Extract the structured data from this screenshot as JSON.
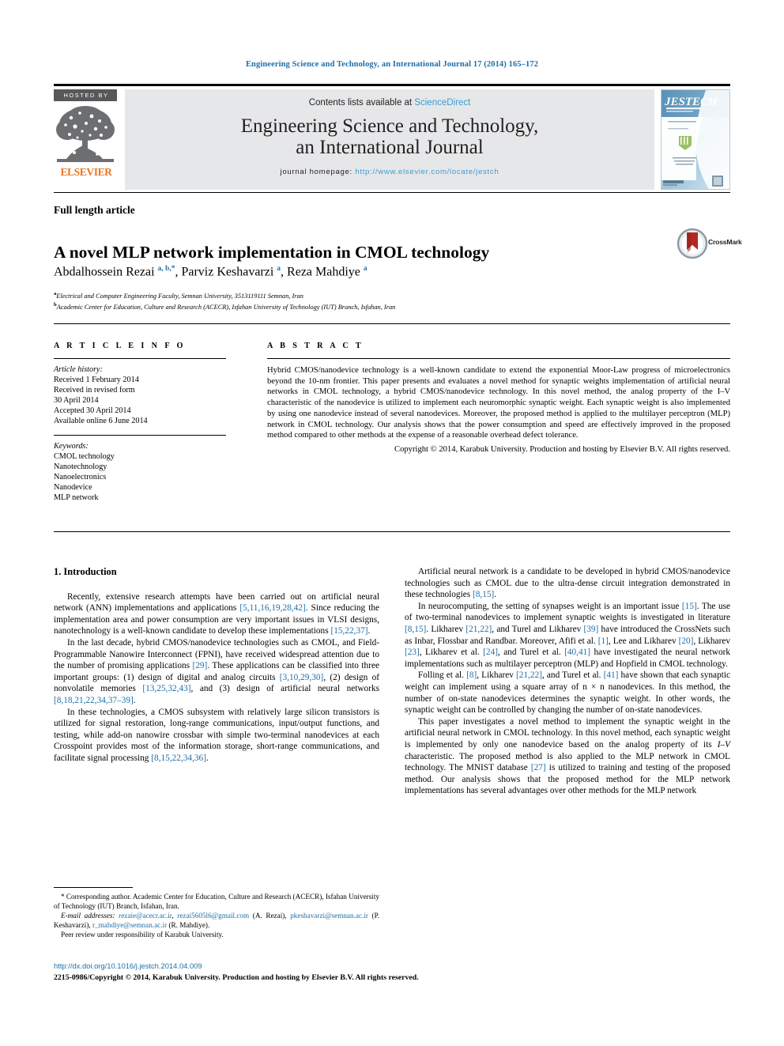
{
  "running_head": "Engineering Science and Technology, an International Journal 17 (2014) 165–172",
  "masthead": {
    "hosted_by": "HOSTED BY",
    "publisher": "ELSEVIER",
    "contents_prefix": "Contents lists available at ",
    "contents_link": "ScienceDirect",
    "journal_line1": "Engineering Science and Technology,",
    "journal_line2": "an International Journal",
    "homepage_label": "journal homepage: ",
    "homepage_url": "http://www.elsevier.com/locate/jestch",
    "cover_title": "JESTECH",
    "cover_subtitle": "ENGINEERING SCIENCE AND TECHNOLOGY",
    "cover_sub2": "an International Journal"
  },
  "article": {
    "type": "Full length article",
    "title": "A novel MLP network implementation in CMOL technology",
    "crossmark_label": "CrossMark",
    "authors_html": "Abdalhossein Rezai <sup>a, b,</sup><sup>*</sup>, Parviz Keshavarzi <sup>a</sup>, Reza Mahdiye <sup>a</sup>",
    "affiliation_a": "Electrical and Computer Engineering Faculty, Semnan University, 3513119111 Semnan, Iran",
    "affiliation_b": "Academic Center for Education, Culture and Research (ACECR), Isfahan University of Technology (IUT) Branch, Isfahan, Iran"
  },
  "article_info": {
    "heading": "A R T I C L E   I N F O",
    "history_label": "Article history:",
    "history": [
      "Received 1 February 2014",
      "Received in revised form",
      "30 April 2014",
      "Accepted 30 April 2014",
      "Available online 6 June 2014"
    ],
    "keywords_label": "Keywords:",
    "keywords": [
      "CMOL technology",
      "Nanotechnology",
      "Nanoelectronics",
      "Nanodevice",
      "MLP network"
    ]
  },
  "abstract": {
    "heading": "A B S T R A C T",
    "body_html": "Hybrid CMOS/nanodevice technology is a well-known candidate to extend the exponential Moor-Law progress of microelectronics beyond the 10-nm frontier. This paper presents and evaluates a novel method for synaptic weights implementation of artificial neural networks in CMOL technology, a hybrid CMOS/nanodevice technology. In this novel method, the analog property of the <span class=\"it\">I&#8211;V</span> characteristic of the nanodevice is utilized to implement each neuromorphic synaptic weight. Each synaptic weight is also implemented by using one nanodevice instead of several nanodevices. Moreover, the proposed method is applied to the multilayer perceptron (MLP) network in CMOL technology. Our analysis shows that the power consumption and speed are effectively improved in the proposed method compared to other methods at the expense of a reasonable overhead defect tolerance.",
    "copyright": "Copyright © 2014, Karabuk University. Production and hosting by Elsevier B.V. All rights reserved."
  },
  "body": {
    "section_heading": "1. Introduction",
    "left_paragraphs_html": [
      "Recently, extensive research attempts have been carried out on artificial neural network (ANN) implementations and applications <span class=\"ref\">[5,11,16,19,28,42]</span>. Since reducing the implementation area and power consumption are very important issues in VLSI designs, nanotechnology is a well-known candidate to develop these implementations <span class=\"ref\">[15,22,37]</span>.",
      "In the last decade, hybrid CMOS/nanodevice technologies such as CMOL, and Field-Programmable Nanowire Interconnect (FPNI), have received widespread attention due to the number of promising applications <span class=\"ref\">[29]</span>. These applications can be classified into three important groups: (1) design of digital and analog circuits <span class=\"ref\">[3,10,29,30]</span>, (2) design of nonvolatile memories <span class=\"ref\">[13,25,32,43]</span>, and (3) design of artificial neural networks <span class=\"ref\">[8,18,21,22,34,37&#8211;39]</span>.",
      "In these technologies, a CMOS subsystem with relatively large silicon transistors is utilized for signal restoration, long-range communications, input/output functions, and testing, while add-on nanowire crossbar with simple two-terminal nanodevices at each Crosspoint provides most of the information storage, short-range communications, and facilitate signal processing <span class=\"ref\">[8,15,22,34,36]</span>."
    ],
    "right_paragraphs_html": [
      "Artificial neural network is a candidate to be developed in hybrid CMOS/nanodevice technologies such as CMOL due to the ultra-dense circuit integration demonstrated in these technologies <span class=\"ref\">[8,15]</span>.",
      "In neurocomputing, the setting of synapses weight is an important issue <span class=\"ref\">[15]</span>. The use of two-terminal nanodevices to implement synaptic weights is investigated in literature <span class=\"ref\">[8,15]</span>. Likharev <span class=\"ref\">[21,22]</span>, and Turel and Likharev <span class=\"ref\">[39]</span> have introduced the CrossNets such as Inbar, Flossbar and Randbar. Moreover, Afifi et al. <span class=\"ref\">[1]</span>, Lee and Likharev <span class=\"ref\">[20]</span>, Likharev <span class=\"ref\">[23]</span>, Likharev et al. <span class=\"ref\">[24]</span>, and Turel et al. <span class=\"ref\">[40,41]</span> have investigated the neural network implementations such as multilayer perceptron (MLP) and Hopfield in CMOL technology.",
      "Folling et al. <span class=\"ref\">[8]</span>, Likharev <span class=\"ref\">[21,22]</span>, and Turel et al. <span class=\"ref\">[41]</span> have shown that each synaptic weight can implement using a square array of n × n nanodevices. In this method, the number of on-state nanodevices determines the synaptic weight. In other words, the synaptic weight can be controlled by changing the number of on-state nanodevices.",
      "This paper investigates a novel method to implement the synaptic weight in the artificial neural network in CMOL technology. In this novel method, each synaptic weight is implemented by only one nanodevice based on the analog property of its <span class=\"it\">I&#8211;V</span> characteristic. The proposed method is also applied to the MLP network in CMOL technology. The MNIST database <span class=\"ref\">[27]</span> is utilized to training and testing of the proposed method. Our analysis shows that the proposed method for the MLP network implementations has several advantages over other methods for the MLP network"
    ]
  },
  "footnotes": {
    "corresponding_html": "* Corresponding author. Academic Center for Education, Culture and Research (ACECR), Isfahan University of Technology (IUT) Branch, Isfahan, Iran.",
    "emails_html": "<span class=\"it\">E-mail addresses:</span> <span class=\"mail\">rezaie@acecr.ac.ir</span>, <span class=\"mail\">rezai5605l6@gmail.com</span> (A. Rezai), <span class=\"mail\">pkeshavarzi@semnan.ac.ir</span> (P. Keshavarzi), <span class=\"mail\">r_mahdiye@semnan.ac.ir</span> (R. Mahdiye).",
    "peer_review": "Peer review under responsibility of Karabuk University."
  },
  "footer": {
    "doi": "http://dx.doi.org/10.1016/j.jestch.2014.04.009",
    "copyright": "2215-0986/Copyright © 2014, Karabuk University. Production and hosting by Elsevier B.V. All rights reserved."
  },
  "colors": {
    "link": "#1f6fa8",
    "sciencedirect": "#3e9bd4",
    "elsevier_orange": "#e87722",
    "band_gray": "#e6e7e8",
    "crossmark_red": "#b4291f"
  }
}
